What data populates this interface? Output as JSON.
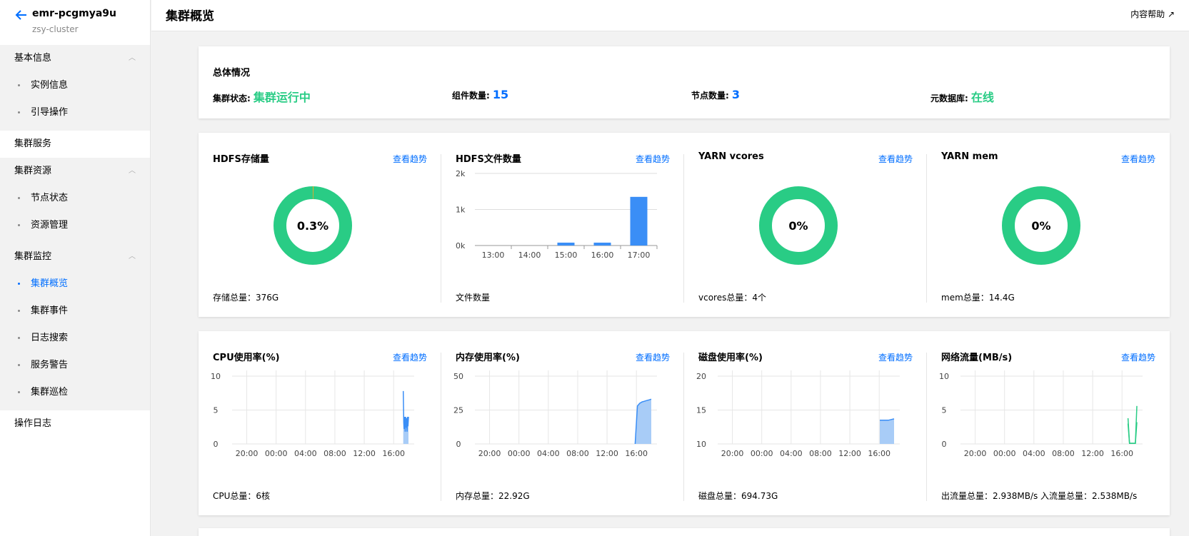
{
  "sidebar": {
    "cluster_id": "emr-pcgmya9u",
    "cluster_name": "zsy-cluster",
    "groups": [
      {
        "title": "基本信息",
        "items": [
          "实例信息",
          "引导操作"
        ]
      },
      {
        "title": "集群服务"
      },
      {
        "title": "集群资源",
        "items": [
          "节点状态",
          "资源管理"
        ]
      },
      {
        "title": "集群监控",
        "items": [
          "集群概览",
          "集群事件",
          "日志搜索",
          "服务警告",
          "集群巡检"
        ]
      },
      {
        "title": "操作日志"
      }
    ],
    "active_item": "集群概览"
  },
  "header": {
    "title": "集群概览",
    "help_label": "内容帮助"
  },
  "summary": {
    "title": "总体情况",
    "cluster_status_label": "集群状态:",
    "cluster_status_value": "集群运行中",
    "components_label": "组件数量:",
    "components_value": "15",
    "nodes_label": "节点数量:",
    "nodes_value": "3",
    "metadb_label": "元数据库:",
    "metadb_value": "在线"
  },
  "trend_link": "查看趋势",
  "row1": [
    {
      "title": "HDFS存储量",
      "footer": "存储总量：376G"
    },
    {
      "title": "HDFS文件数量",
      "footer": "文件数量"
    },
    {
      "title": "YARN vcores",
      "footer": "vcores总量：4个"
    },
    {
      "title": "YARN mem",
      "footer": "mem总量：14.4G"
    }
  ],
  "row2": [
    {
      "title": "CPU使用率(%)",
      "footer": "CPU总量：6核"
    },
    {
      "title": "内存使用率(%)",
      "footer": "内存总量：22.92G"
    },
    {
      "title": "磁盘使用率(%)",
      "footer": "磁盘总量：694.73G"
    },
    {
      "title": "网络流量(MB/s)",
      "footer": "出流量总量：2.938MB/s 入流量总量：2.538MB/s"
    }
  ],
  "colors": {
    "green": "#29cc85",
    "blue": "#006eff",
    "bar": "#3a8ef6",
    "area": "#a8ccf7",
    "line": "#3a8ef6"
  },
  "chart_data": [
    {
      "type": "pie",
      "title": "HDFS存储量",
      "center_label": "0.3%",
      "values": [
        0.3,
        99.7
      ]
    },
    {
      "type": "bar",
      "title": "HDFS文件数量",
      "categories": [
        "13:00",
        "14:00",
        "15:00",
        "16:00",
        "17:00"
      ],
      "values": [
        0,
        0,
        80,
        80,
        1350
      ],
      "yticks": [
        "0k",
        "1k",
        "2k"
      ],
      "ylim": [
        0,
        2000
      ]
    },
    {
      "type": "pie",
      "title": "YARN vcores",
      "center_label": "0%",
      "values": [
        0,
        100
      ]
    },
    {
      "type": "pie",
      "title": "YARN mem",
      "center_label": "0%",
      "values": [
        0,
        100
      ]
    },
    {
      "type": "area",
      "title": "CPU使用率(%)",
      "xticks": [
        "20:00",
        "00:00",
        "04:00",
        "08:00",
        "12:00",
        "16:00"
      ],
      "yticks": [
        "0",
        "5",
        "10"
      ],
      "ylim": [
        0,
        10
      ],
      "series": [
        {
          "values": [
            7.8,
            3.2,
            2.2,
            4,
            1.8,
            4,
            2.4,
            3.8,
            1.8,
            4,
            2.6,
            4
          ]
        }
      ]
    },
    {
      "type": "area",
      "title": "内存使用率(%)",
      "xticks": [
        "20:00",
        "00:00",
        "04:00",
        "08:00",
        "12:00",
        "16:00"
      ],
      "yticks": [
        "0",
        "25",
        "50"
      ],
      "ylim": [
        0,
        50
      ],
      "series": [
        {
          "values": [
            0,
            28,
            30,
            31,
            31.5,
            32,
            32.5,
            33
          ]
        }
      ]
    },
    {
      "type": "area",
      "title": "磁盘使用率(%)",
      "xticks": [
        "20:00",
        "00:00",
        "04:00",
        "08:00",
        "12:00",
        "16:00"
      ],
      "yticks": [
        "10",
        "15",
        "20"
      ],
      "ylim": [
        10,
        20
      ],
      "series": [
        {
          "values": [
            13.5,
            13.5,
            13.5,
            13.5,
            13.6,
            13.7
          ]
        }
      ]
    },
    {
      "type": "line",
      "title": "网络流量(MB/s)",
      "xticks": [
        "20:00",
        "00:00",
        "04:00",
        "08:00",
        "12:00",
        "16:00"
      ],
      "yticks": [
        "0",
        "5",
        "10"
      ],
      "ylim": [
        0,
        10
      ],
      "series": [
        {
          "name": "出流量",
          "values": [
            3.8,
            0.1,
            0.1,
            0.1,
            0.1,
            0.1,
            5.6
          ]
        },
        {
          "name": "入流量",
          "values": [
            3,
            0.1,
            0.1,
            0.1,
            0.1,
            0.1,
            3.2
          ]
        }
      ]
    }
  ]
}
